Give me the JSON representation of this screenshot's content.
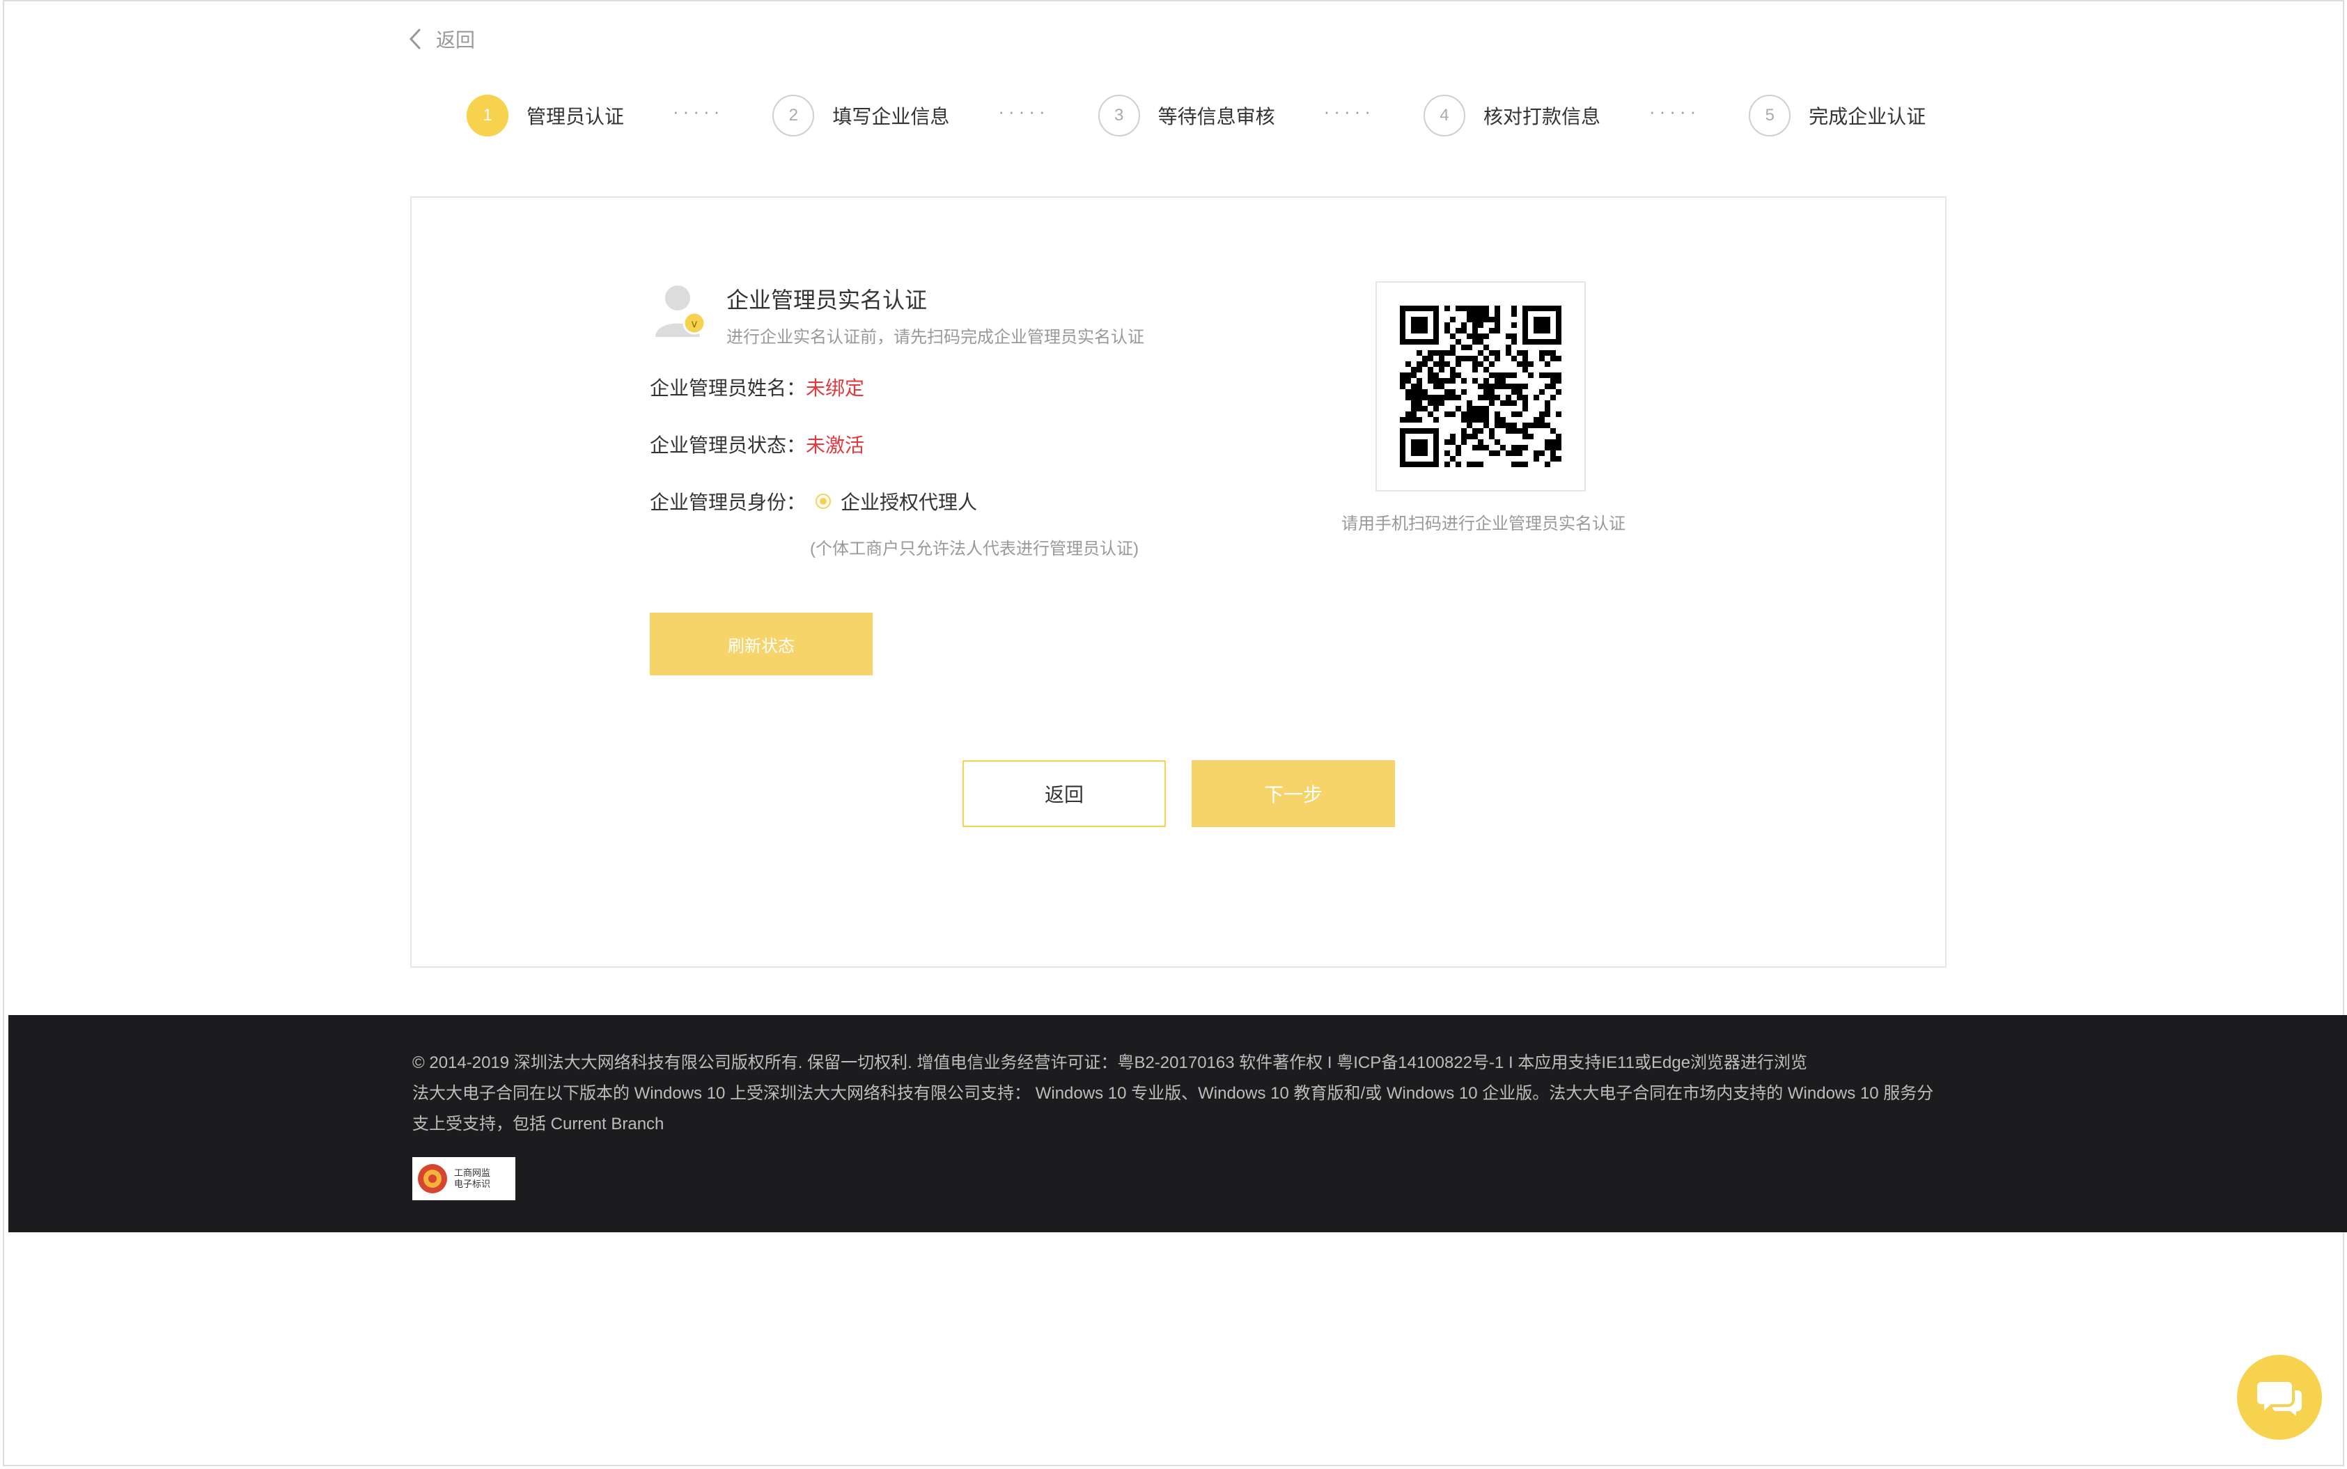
{
  "header": {
    "back_label": "返回"
  },
  "steps": [
    {
      "num": "1",
      "label": "管理员认证"
    },
    {
      "num": "2",
      "label": "填写企业信息"
    },
    {
      "num": "3",
      "label": "等待信息审核"
    },
    {
      "num": "4",
      "label": "核对打款信息"
    },
    {
      "num": "5",
      "label": "完成企业认证"
    }
  ],
  "step_separator": "·····",
  "section": {
    "title": "企业管理员实名认证",
    "subtitle": "进行企业实名认证前，请先扫码完成企业管理员实名认证"
  },
  "fields": {
    "name_label": "企业管理员姓名：",
    "name_value": "未绑定",
    "status_label": "企业管理员状态：",
    "status_value": "未激活",
    "identity_label": "企业管理员身份：",
    "identity_option": "企业授权代理人",
    "identity_hint": "(个体工商户只允许法人代表进行管理员认证)"
  },
  "refresh_button": "刷新状态",
  "qr_caption": "请用手机扫码进行企业管理员实名认证",
  "buttons": {
    "back": "返回",
    "next": "下一步"
  },
  "footer": {
    "line1": "© 2014-2019 深圳法大大网络科技有限公司版权所有. 保留一切权利. 增值电信业务经营许可证：粤B2-20170163 软件著作权  I  粤ICP备14100822号-1 I  本应用支持IE11或Edge浏览器进行浏览",
    "line2": "法大大电子合同在以下版本的 Windows 10 上受深圳法大大网络科技有限公司支持： Windows 10 专业版、Windows 10 教育版和/或 Windows 10 企业版。法大大电子合同在市场内支持的 Windows 10 服务分",
    "line3": "支上受支持，包括 Current Branch",
    "badge_line1": "工商网监",
    "badge_line2": "电子标识"
  },
  "colors": {
    "accent": "#f7d24f",
    "warning_text": "#e0393e",
    "footer_bg": "#1c1c1e"
  },
  "icons": {
    "back": "chevron-left-icon",
    "avatar": "user-verified-icon",
    "chat": "chat-bubbles-icon",
    "badge": "emblem-icon"
  }
}
